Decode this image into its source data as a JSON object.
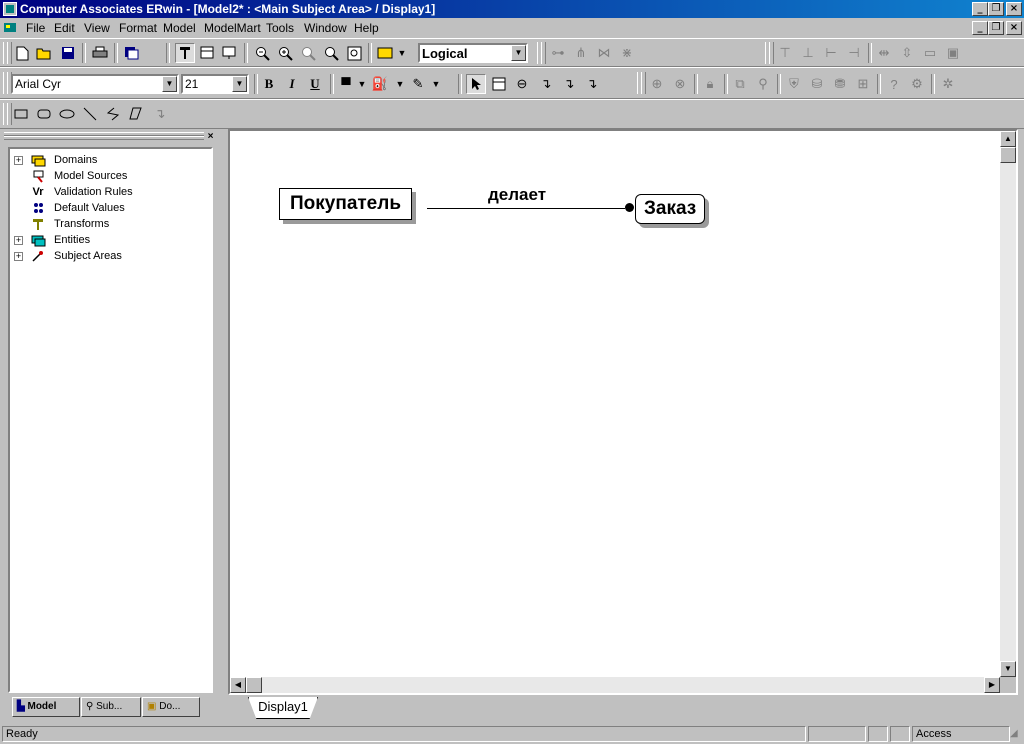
{
  "window": {
    "title": "Computer Associates ERwin - [Model2* : <Main Subject Area> / Display1]"
  },
  "menu": [
    {
      "label": "File"
    },
    {
      "label": "Edit"
    },
    {
      "label": "View"
    },
    {
      "label": "Format"
    },
    {
      "label": "Model"
    },
    {
      "label": "ModelMart"
    },
    {
      "label": "Tools"
    },
    {
      "label": "Window"
    },
    {
      "label": "Help"
    }
  ],
  "toolbar": {
    "view_mode": "Logical",
    "font_name": "Arial Cyr",
    "font_size": "21",
    "bold_label": "B",
    "italic_label": "I",
    "underline_label": "U"
  },
  "tree": {
    "items": [
      {
        "label": "Domains",
        "icon": "domains-icon",
        "expandable": true
      },
      {
        "label": "Model Sources",
        "icon": "model-sources-icon",
        "expandable": false
      },
      {
        "label": "Validation Rules",
        "icon": "validation-rules-icon",
        "expandable": false
      },
      {
        "label": "Default Values",
        "icon": "default-values-icon",
        "expandable": false
      },
      {
        "label": "Transforms",
        "icon": "transforms-icon",
        "expandable": false
      },
      {
        "label": "Entities",
        "icon": "entities-icon",
        "expandable": true
      },
      {
        "label": "Subject Areas",
        "icon": "subject-areas-icon",
        "expandable": true
      }
    ],
    "tabs": [
      {
        "label": "Model",
        "active": true
      },
      {
        "label": "Sub...",
        "active": false
      },
      {
        "label": "Do...",
        "active": false
      }
    ]
  },
  "diagram": {
    "entities": [
      {
        "name": "Покупатель"
      },
      {
        "name": "Заказ"
      }
    ],
    "relationship": {
      "label": "делает"
    },
    "tab": "Display1"
  },
  "status": {
    "left": "Ready",
    "mode": "Access"
  },
  "colors": {
    "titlebar_start": "#000080",
    "titlebar_end": "#1084d0",
    "face": "#c0c0c0"
  }
}
